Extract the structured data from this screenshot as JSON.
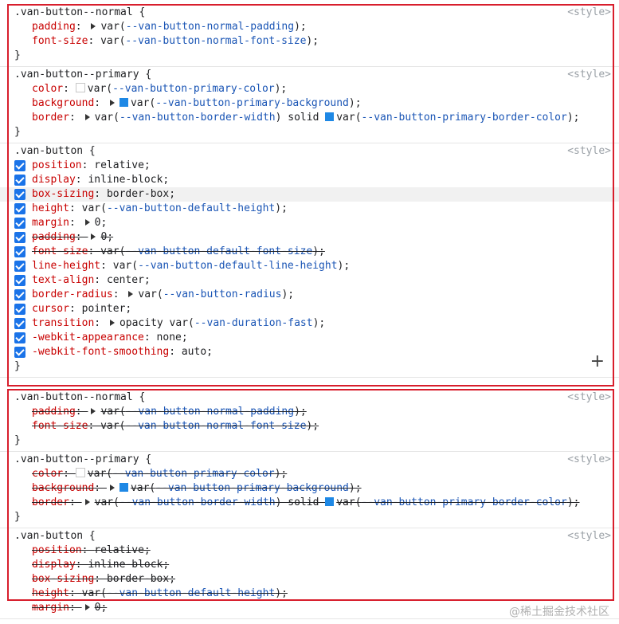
{
  "origin_label": "<style>",
  "top_panel": [
    {
      "selector": ".van-button--normal {",
      "decls": [
        {
          "prop": "padding",
          "tri": true,
          "value_pre": "var(",
          "var": "--van-button-normal-padding",
          "value_post": ");"
        },
        {
          "prop": "font-size",
          "value_pre": "var(",
          "var": "--van-button-normal-font-size",
          "value_post": ");"
        }
      ]
    },
    {
      "selector": ".van-button--primary {",
      "decls": [
        {
          "prop": "color",
          "swatch": "white",
          "value_pre": "var(",
          "var": "--van-button-primary-color",
          "value_post": ");"
        },
        {
          "prop": "background",
          "tri": true,
          "swatch": "blue",
          "value_pre": "var(",
          "var": "--van-button-primary-background",
          "value_post": ");"
        },
        {
          "prop": "border",
          "tri": true,
          "value_pre": "var(",
          "var": "--van-button-border-width",
          "value_mid": ") solid ",
          "swatch2": "blue",
          "value_pre2": "var(",
          "var2": "--van-button-primary-border-color",
          "value_post": ");"
        }
      ]
    },
    {
      "selector": ".van-button {",
      "decls": [
        {
          "prop": "position",
          "value_pre": "relative;"
        },
        {
          "prop": "display",
          "value_pre": "inline-block;"
        },
        {
          "prop": "box-sizing",
          "value_pre": "border-box;",
          "highlight": true
        },
        {
          "prop": "height",
          "value_pre": "var(",
          "var": "--van-button-default-height",
          "value_post": ");"
        },
        {
          "prop": "margin",
          "tri": true,
          "value_pre": "0;"
        },
        {
          "prop": "padding",
          "tri": true,
          "value_pre": "0;",
          "strike": true
        },
        {
          "prop": "font-size",
          "value_pre": "var(",
          "var": "--van-button-default-font-size",
          "value_post": ");",
          "strike": true
        },
        {
          "prop": "line-height",
          "value_pre": "var(",
          "var": "--van-button-default-line-height",
          "value_post": ");"
        },
        {
          "prop": "text-align",
          "value_pre": "center;"
        },
        {
          "prop": "border-radius",
          "tri": true,
          "value_pre": "var(",
          "var": "--van-button-radius",
          "value_post": ");"
        },
        {
          "prop": "cursor",
          "value_pre": "pointer;"
        },
        {
          "prop": "transition",
          "tri": true,
          "value_pre": "opacity var(",
          "var": "--van-duration-fast",
          "value_post": ");"
        },
        {
          "prop": "-webkit-appearance",
          "value_pre": "none;"
        },
        {
          "prop": "-webkit-font-smoothing",
          "value_pre": "auto;"
        }
      ]
    }
  ],
  "bottom_panel": [
    {
      "selector": ".van-button--normal {",
      "decls": [
        {
          "prop": "padding",
          "tri": true,
          "value_pre": "var(",
          "var": "--van-button-normal-padding",
          "value_post": ");"
        },
        {
          "prop": "font-size",
          "value_pre": "var(",
          "var": "--van-button-normal-font-size",
          "value_post": ");"
        }
      ]
    },
    {
      "selector": ".van-button--primary {",
      "decls": [
        {
          "prop": "color",
          "swatch": "white",
          "value_pre": "var(",
          "var": "--van-button-primary-color",
          "value_post": ");"
        },
        {
          "prop": "background",
          "tri": true,
          "swatch": "blue",
          "value_pre": "var(",
          "var": "--van-button-primary-background",
          "value_post": ");"
        },
        {
          "prop": "border",
          "tri": true,
          "value_pre": "var(",
          "var": "--van-button-border-width",
          "value_mid": ") solid ",
          "swatch2": "blue",
          "value_pre2": "var(",
          "var2": "--van-button-primary-border-color",
          "value_post": ");"
        }
      ]
    },
    {
      "selector": ".van-button {",
      "decls": [
        {
          "prop": "position",
          "value_pre": "relative;"
        },
        {
          "prop": "display",
          "value_pre": "inline-block;"
        },
        {
          "prop": "box-sizing",
          "value_pre": "border-box;"
        },
        {
          "prop": "height",
          "value_pre": "var(",
          "var": "--van-button-default-height",
          "value_post": ");"
        },
        {
          "prop": "margin",
          "tri": true,
          "value_pre": "0;"
        }
      ]
    }
  ],
  "watermark": "@稀土掘金技术社区",
  "colors": {
    "accent": "#1a73e8",
    "property": "#c80000",
    "variable": "#1a55b5",
    "frame": "#d81e2c"
  }
}
